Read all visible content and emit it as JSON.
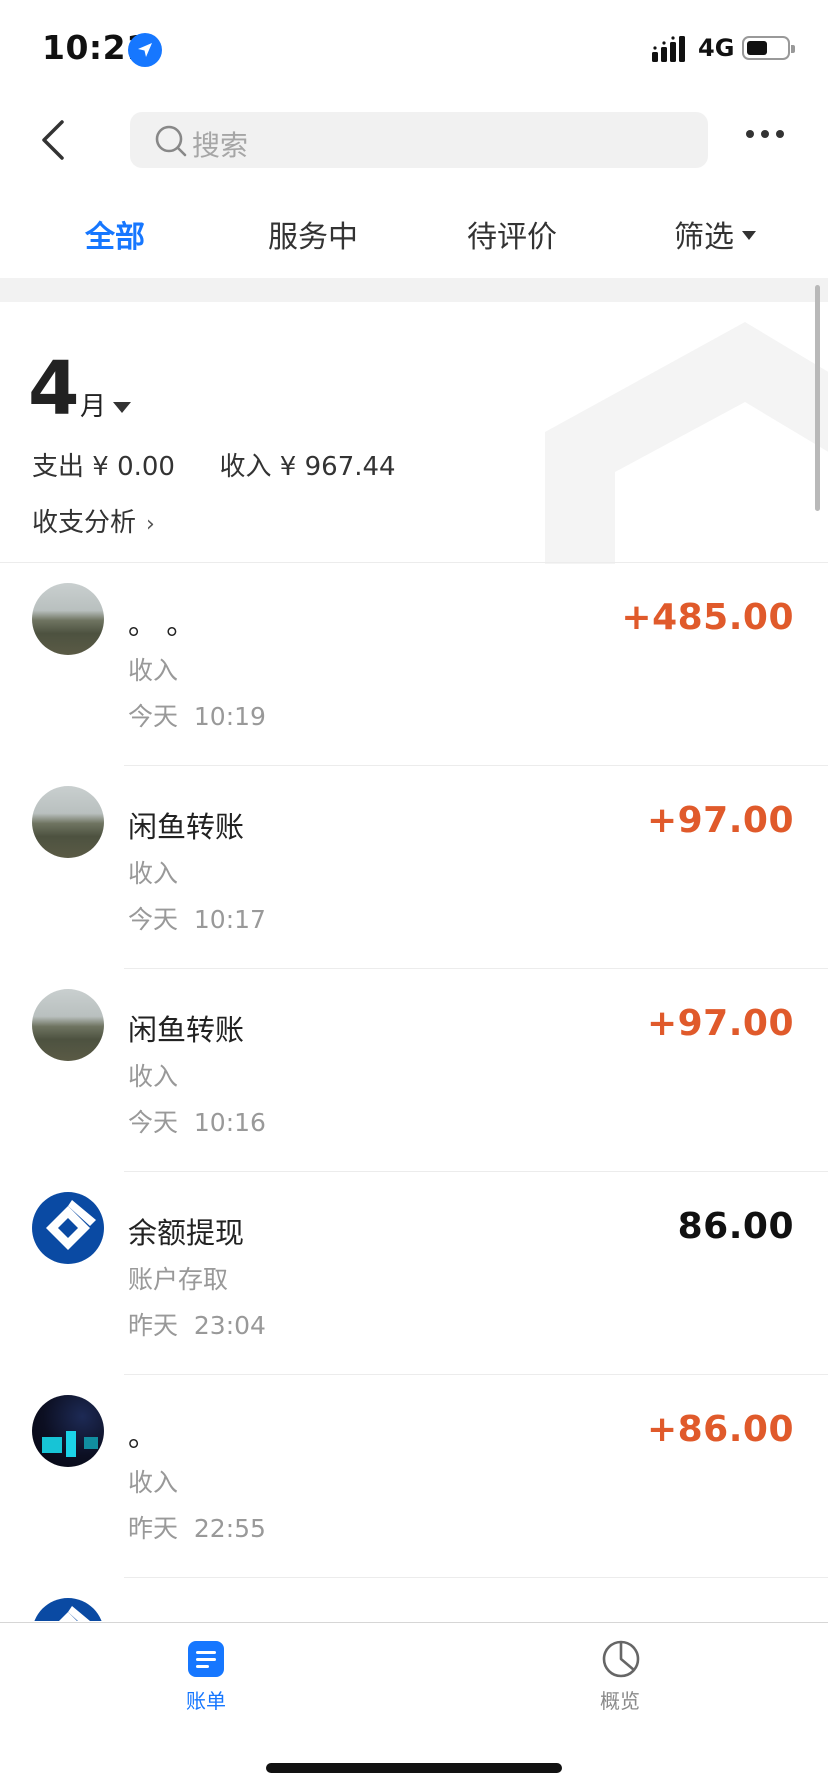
{
  "status_bar": {
    "time": "10:21",
    "network": "4G"
  },
  "header": {
    "search_placeholder": "搜索"
  },
  "tabs": [
    {
      "label": "全部",
      "active": true
    },
    {
      "label": "服务中",
      "active": false
    },
    {
      "label": "待评价",
      "active": false
    },
    {
      "label": "筛选",
      "active": false
    }
  ],
  "summary": {
    "month_number": "4",
    "month_unit": "月",
    "expense_label": "支出",
    "expense_value": "¥ 0.00",
    "income_label": "收入",
    "income_value": "¥ 967.44",
    "analysis_label": "收支分析"
  },
  "transactions": [
    {
      "title": "。 。",
      "category": "收入",
      "time": "今天  10:19",
      "amount": "+485.00",
      "type": "income",
      "avatar": "landscape"
    },
    {
      "title": "闲鱼转账",
      "category": "收入",
      "time": "今天  10:17",
      "amount": "+97.00",
      "type": "income",
      "avatar": "landscape"
    },
    {
      "title": "闲鱼转账",
      "category": "收入",
      "time": "今天  10:16",
      "amount": "+97.00",
      "type": "income",
      "avatar": "landscape"
    },
    {
      "title": "余额提现",
      "category": "账户存取",
      "time": "昨天  23:04",
      "amount": "86.00",
      "type": "neutral",
      "avatar": "bank"
    },
    {
      "title": "。",
      "category": "收入",
      "time": "昨天  22:55",
      "amount": "+86.00",
      "type": "income",
      "avatar": "night"
    }
  ],
  "bottom_nav": {
    "bills_label": "账单",
    "overview_label": "概览"
  },
  "colors": {
    "accent": "#1677ff",
    "income": "#e05a2b",
    "bank_logo": "#0a4aa3"
  }
}
